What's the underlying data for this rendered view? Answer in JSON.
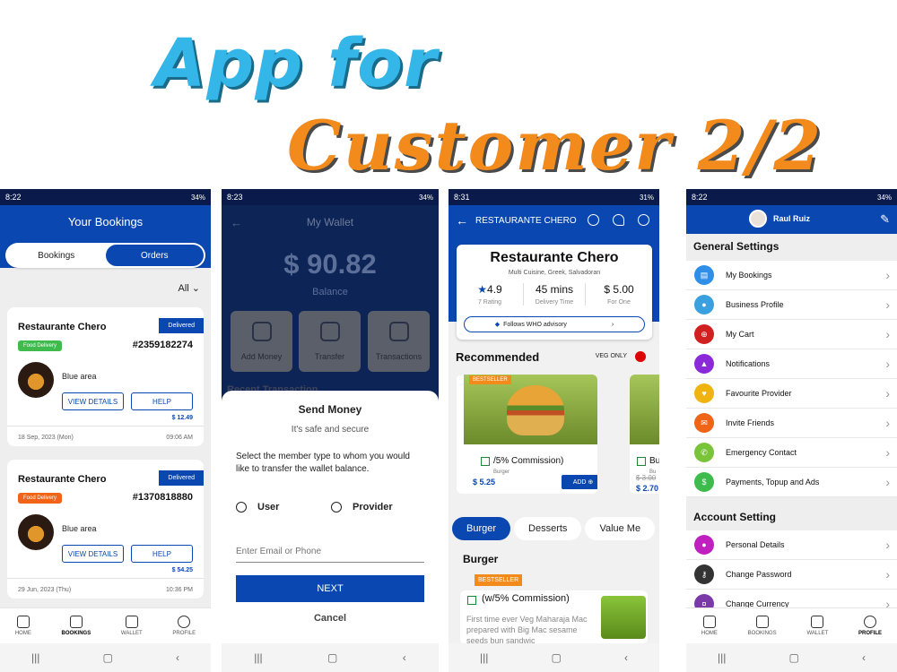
{
  "banner": {
    "line1": "App for",
    "line2": "Customer 2/2"
  },
  "bookings": {
    "status_time": "8:22",
    "battery": "34%",
    "title": "Your Bookings",
    "tab_bookings": "Bookings",
    "tab_orders": "Orders",
    "filter": "All",
    "cards": [
      {
        "restaurant": "Restaurante Chero",
        "status": "Delivered",
        "tag": "Food Delivery",
        "tag_color": "#3dbb4c",
        "order_no": "#2359182274",
        "area": "Blue area",
        "view": "VIEW DETAILS",
        "help": "HELP",
        "price": "$ 12.49",
        "date": "18 Sep, 2023 (Mon)",
        "time": "09:06 AM"
      },
      {
        "restaurant": "Restaurante Chero",
        "status": "Delivered",
        "tag": "Food Delivery",
        "tag_color": "#f06418",
        "order_no": "#1370818880",
        "area": "Blue area",
        "view": "VIEW DETAILS",
        "help": "HELP",
        "price": "$ 54.25",
        "date": "29 Jun, 2023 (Thu)",
        "time": "10:36 PM"
      }
    ],
    "nav": [
      "HOME",
      "BOOKINGS",
      "WALLET",
      "PROFILE"
    ]
  },
  "wallet": {
    "status_time": "8:23",
    "battery": "34%",
    "title": "My Wallet",
    "amount": "$ 90.82",
    "balance_label": "Balance",
    "tiles": [
      "Add Money",
      "Transfer",
      "Transactions"
    ],
    "recent": "Recent Transaction",
    "sheet_title": "Send Money",
    "sheet_sub": "It's safe and secure",
    "sheet_desc": "Select the member type to whom you would like to transfer the wallet balance.",
    "option_user": "User",
    "option_provider": "Provider",
    "input_placeholder": "Enter Email or Phone",
    "next": "NEXT",
    "cancel": "Cancel"
  },
  "restaurant": {
    "status_time": "8:31",
    "battery": "31%",
    "header": "RESTAURANTE CHERO",
    "name": "Restaurante Chero",
    "cuisine": "Multi Cuisine, Greek, Salvadoran",
    "rating": "4.9",
    "rating_label": "7 Rating",
    "delivery": "45 mins",
    "delivery_label": "Delivery Time",
    "cost": "$ 5.00",
    "cost_label": "For One",
    "who": "Follows WHO advisory",
    "recommended": "Recommended",
    "veg_only": "VEG ONLY",
    "bestseller": "BESTSELLER",
    "item_name": "/5% Commission)",
    "item_cat": "Burger",
    "item_price": "$ 5.25",
    "add": "ADD",
    "item2_name_peek": "Bu",
    "item2_cat_peek": "Bu",
    "item2_old_peek": "$ 3.00",
    "item2_price_peek": "$ 2.70",
    "chips": [
      "Burger",
      "Desserts",
      "Value Me"
    ],
    "section": "Burger",
    "item3_name": "(w/5% Commission)",
    "item3_desc": "First time ever Veg Maharaja Mac prepared with Big Mac sesame seeds bun sandwic"
  },
  "profile": {
    "status_time": "8:22",
    "battery": "34%",
    "user": "Raul Ruiz",
    "general": "General Settings",
    "items": [
      {
        "label": "My Bookings",
        "color": "#2f8fe8"
      },
      {
        "label": "Business Profile",
        "color": "#3aa0e0"
      },
      {
        "label": "My Cart",
        "color": "#d02020"
      },
      {
        "label": "Notifications",
        "color": "#8a2ad8"
      },
      {
        "label": "Favourite Provider",
        "color": "#f0b410"
      },
      {
        "label": "Invite Friends",
        "color": "#f06418"
      },
      {
        "label": "Emergency Contact",
        "color": "#7ac43a"
      },
      {
        "label": "Payments, Topup and Ads",
        "color": "#3dbb4c"
      }
    ],
    "account": "Account Setting",
    "account_items": [
      {
        "label": "Personal Details",
        "color": "#c020c0"
      },
      {
        "label": "Change Password",
        "color": "#333333"
      },
      {
        "label": "Change Currency",
        "color": "#7a3aa8"
      }
    ]
  }
}
